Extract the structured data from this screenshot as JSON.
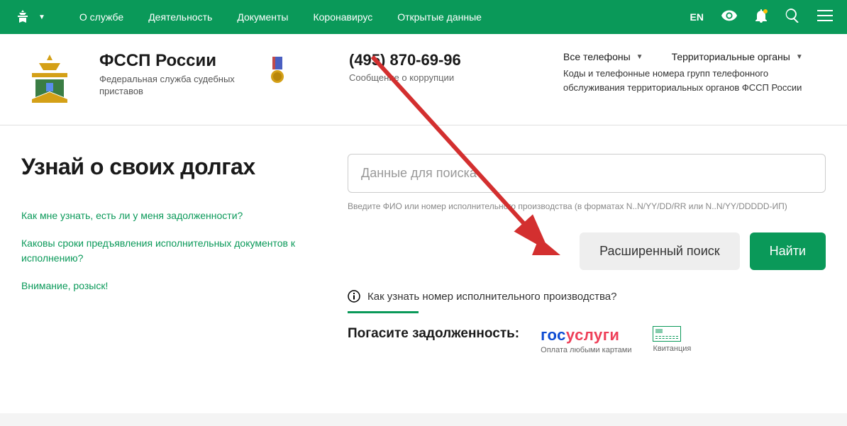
{
  "nav": {
    "items": [
      "О службе",
      "Деятельность",
      "Документы",
      "Коронавирус",
      "Открытые данные"
    ],
    "lang": "EN"
  },
  "header": {
    "title": "ФССП России",
    "subtitle": "Федеральная служба судебных приставов",
    "phone": "(495) 870-69-96",
    "phone_caption": "Сообщение о коррупции",
    "dropdown1": "Все телефоны",
    "dropdown2": "Территориальные органы",
    "right_description": "Коды и телефонные номера групп телефонного обслуживания территориальных органов ФССП России"
  },
  "main": {
    "hero": "Узнай о своих долгах",
    "faq_links": [
      "Как мне узнать, есть ли у меня задолженности?",
      "Каковы сроки предъявления исполнительных документов к исполнению?",
      "Внимание, розыск!"
    ],
    "search_placeholder": "Данные для поиска",
    "search_hint": "Введите ФИО или номер исполнительного производства (в форматах N..N/YY/DD/RR или N..N/YY/DDDDD-ИП)",
    "btn_advanced": "Расширенный поиск",
    "btn_find": "Найти",
    "info_question": "Как узнать номер исполнительного производства?",
    "payment_title": "Погасите задолженность:",
    "gosuslugi_blue": "гос",
    "gosuslugi_red": "услуги",
    "gosuslugi_sub": "Оплата любыми картами",
    "kvit": "Квитанция"
  }
}
